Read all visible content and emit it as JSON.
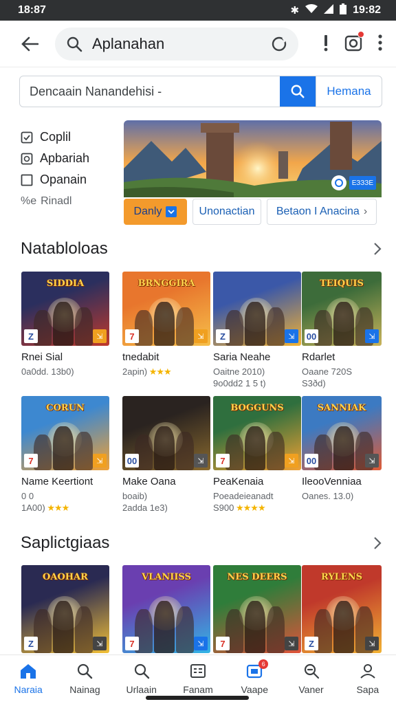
{
  "status": {
    "time_left": "18:87",
    "time_right": "19:82"
  },
  "appbar": {
    "query": "Aplanahan"
  },
  "search": {
    "placeholder": "Dencaain Nanandehisi -",
    "button_label": "Hemana"
  },
  "filters": [
    {
      "label": "Coplil",
      "icon": "square-check-icon"
    },
    {
      "label": "Apbariah",
      "icon": "square-smile-icon"
    },
    {
      "label": "Opanain",
      "icon": "square-icon"
    },
    {
      "label": "Rinadl",
      "prefix": "%e"
    }
  ],
  "banner": {
    "badge_text": "ЕЗЗЗЕ",
    "tabs": [
      "Danly",
      "Unonactian",
      "Betaon I Anacina"
    ]
  },
  "sections": [
    {
      "title": "Natabloloas",
      "cards": [
        {
          "name": "Rnei Sial",
          "meta1": "0a0dd. 13b0)",
          "meta2": "",
          "stars": "",
          "art": "SIDDIA",
          "palette": [
            "#2b2f5e",
            "#c0392b"
          ],
          "corner_l": "Z",
          "corner_r_color": "#f0a020"
        },
        {
          "name": "tnedabit",
          "meta1": "2apin)",
          "meta2": "",
          "stars": "★★★",
          "art": "BRNGGIRA",
          "palette": [
            "#e8762d",
            "#f6c04b"
          ],
          "corner_l": "7",
          "corner_r_color": "#f0a020"
        },
        {
          "name": "Saria Neahe",
          "meta1": "Oaitne 2010)",
          "meta2": "9o0dd2 1 5 t)",
          "stars": "",
          "art": "",
          "palette": [
            "#3b58a8",
            "#f2b233"
          ],
          "corner_l": "Z",
          "corner_r_color": "#1a73e8"
        },
        {
          "name": "Rdarlet",
          "meta1": "Oaane 720S",
          "meta2": "S3ðd)",
          "stars": "",
          "art": "TEIQUIS",
          "palette": [
            "#3d6c3a",
            "#c9b35a"
          ],
          "corner_l": "00",
          "corner_r_color": "#1a73e8"
        }
      ]
    },
    {
      "title": "",
      "cards": [
        {
          "name": "Name Keertiont",
          "meta1": "0 0",
          "meta2": "1A00)",
          "stars": "★★★",
          "art": "CORUN",
          "palette": [
            "#3d88d0",
            "#f2a133"
          ],
          "corner_l": "7",
          "corner_r_color": "#f0a020"
        },
        {
          "name": "Make Oana",
          "meta1": "boaib)",
          "meta2": "2adda 1e3)",
          "stars": "",
          "art": "",
          "palette": [
            "#2a2320",
            "#8a6a2e"
          ],
          "corner_l": "00",
          "corner_r_color": "#555555"
        },
        {
          "name": "PeaKenaia",
          "meta1": "Poeadeieanadt",
          "meta2": "S900",
          "stars": "★★★★",
          "art": "BOGGUNS",
          "palette": [
            "#2f6f3e",
            "#f2a133"
          ],
          "corner_l": "7",
          "corner_r_color": "#f0a020"
        },
        {
          "name": "IleooVenniaa",
          "meta1": "Oanes. 13.0)",
          "meta2": "",
          "stars": "",
          "art": "SANNIAK",
          "palette": [
            "#3c7ac2",
            "#e05a34"
          ],
          "corner_l": "00",
          "corner_r_color": "#555555"
        }
      ]
    },
    {
      "title": "Saplictgiaas",
      "cards": [
        {
          "name": "",
          "meta1": "",
          "meta2": "",
          "stars": "",
          "art": "OAOHAR",
          "palette": [
            "#2a2a52",
            "#f2c037"
          ],
          "corner_l": "Z",
          "corner_r_color": "#444444"
        },
        {
          "name": "",
          "meta1": "",
          "meta2": "",
          "stars": "",
          "art": "VLANIISS",
          "palette": [
            "#6a3fb0",
            "#33b5e5"
          ],
          "corner_l": "7",
          "corner_r_color": "#1a73e8"
        },
        {
          "name": "",
          "meta1": "",
          "meta2": "",
          "stars": "",
          "art": "NES DEERS",
          "palette": [
            "#2f7d3a",
            "#e0533a"
          ],
          "corner_l": "7",
          "corner_r_color": "#444444"
        },
        {
          "name": "",
          "meta1": "",
          "meta2": "",
          "stars": "",
          "art": "RYLENS",
          "palette": [
            "#c0392b",
            "#f2b233"
          ],
          "corner_l": "Z",
          "corner_r_color": "#444444"
        }
      ]
    }
  ],
  "bottom_nav": [
    {
      "label": "Naraia",
      "icon": "home-icon",
      "active": true
    },
    {
      "label": "Nainag",
      "icon": "search-icon"
    },
    {
      "label": "Urlaain",
      "icon": "search-icon"
    },
    {
      "label": "Fanam",
      "icon": "list-icon"
    },
    {
      "label": "Vaape",
      "icon": "apps-icon",
      "badge": "6"
    },
    {
      "label": "Vaner",
      "icon": "search-plus-icon"
    },
    {
      "label": "Sapa",
      "icon": "account-icon"
    }
  ],
  "colors": {
    "accent": "#1a73e8",
    "accent_orange": "#f39a2c",
    "star": "#f4b400"
  }
}
